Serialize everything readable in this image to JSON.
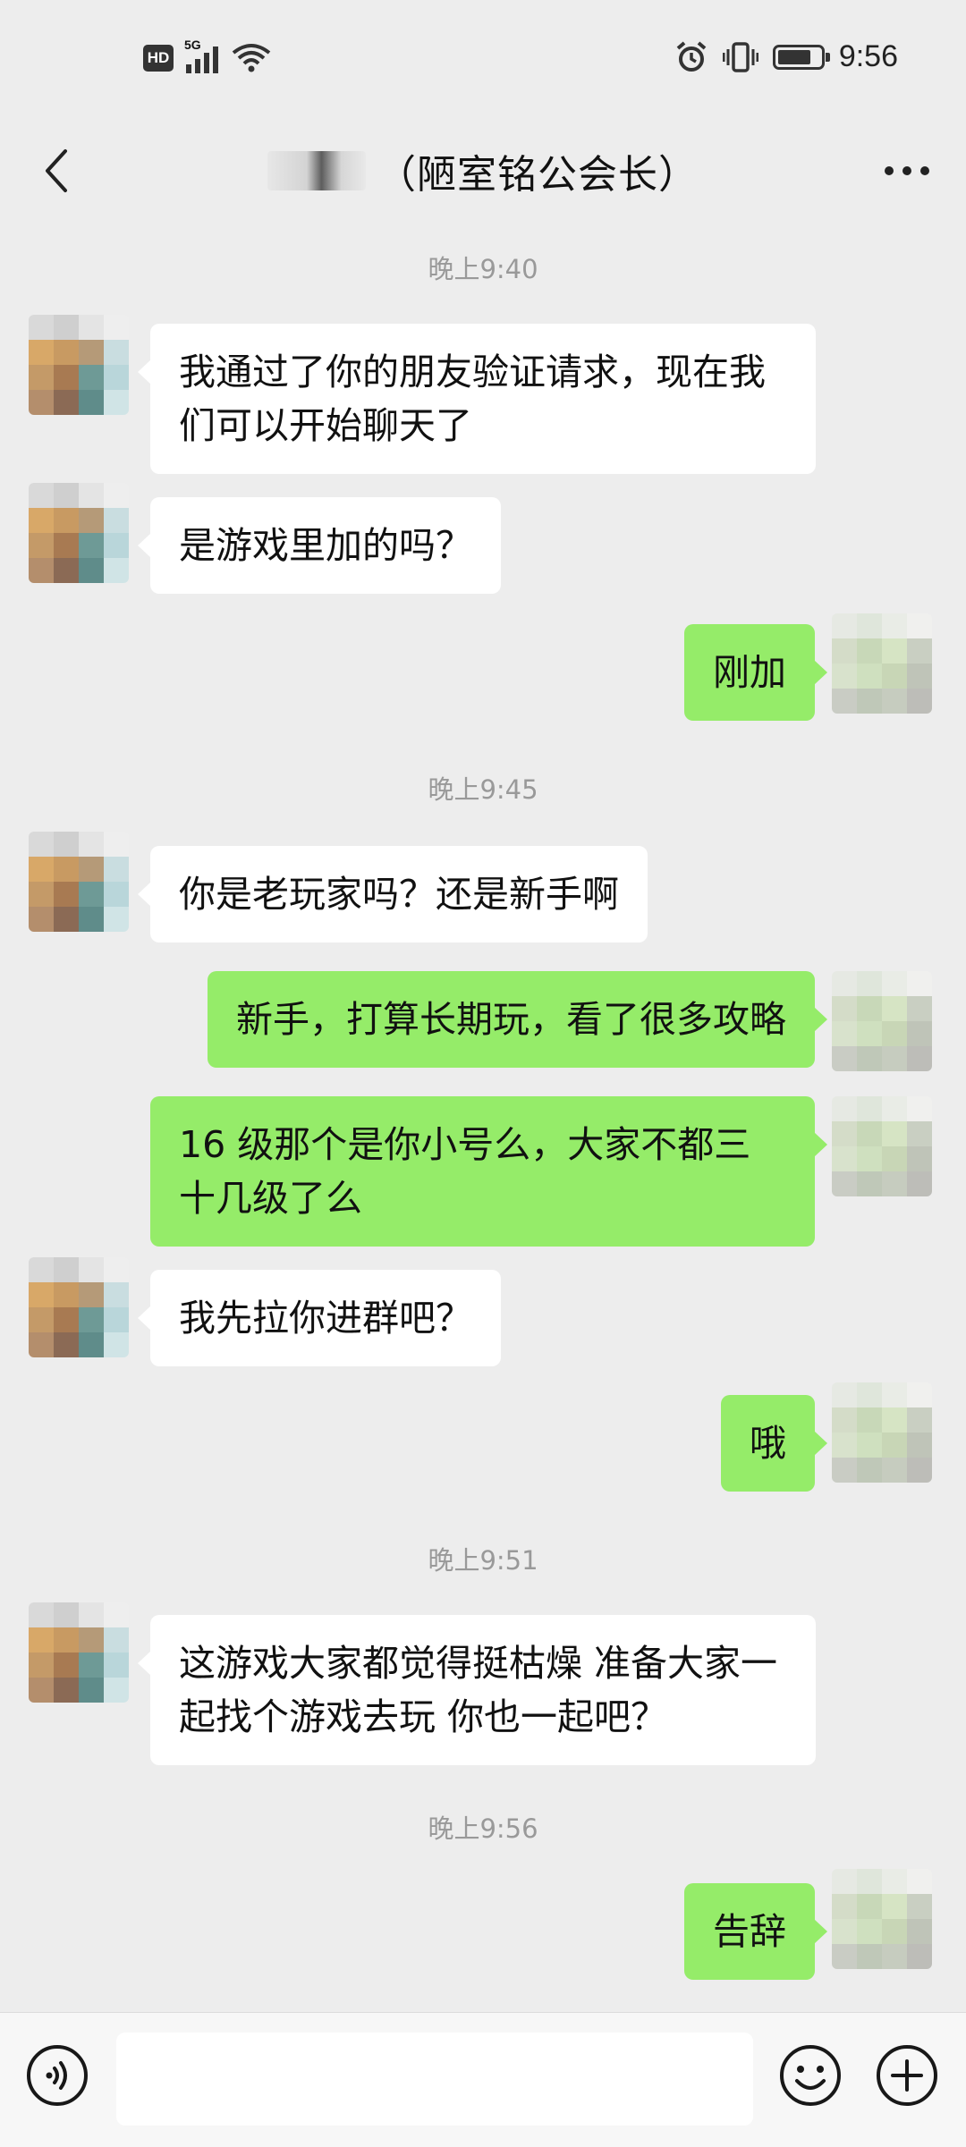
{
  "status_bar": {
    "hd_badge": "HD",
    "network": "5G",
    "time": "9:56",
    "icons": [
      "hd-icon",
      "signal-icon",
      "wifi-icon",
      "alarm-icon",
      "vibrate-icon",
      "battery-icon"
    ]
  },
  "header": {
    "title": "（陋室铭公会长）",
    "back_icon": "chevron-left-icon",
    "more_icon": "more-dots-icon"
  },
  "messages": [
    {
      "type": "timestamp",
      "text": "晚上9:40"
    },
    {
      "type": "in",
      "text": "我通过了你的朋友验证请求，现在我们可以开始聊天了"
    },
    {
      "type": "in",
      "text": "是游戏里加的吗？"
    },
    {
      "type": "out",
      "text": "刚加"
    },
    {
      "type": "timestamp",
      "text": "晚上9:45"
    },
    {
      "type": "in",
      "text": "你是老玩家吗？还是新手啊"
    },
    {
      "type": "out",
      "text": "新手，打算长期玩，看了很多攻略"
    },
    {
      "type": "out",
      "text": "16 级那个是你小号么，大家不都三十几级了么"
    },
    {
      "type": "in",
      "text": "我先拉你进群吧？"
    },
    {
      "type": "out",
      "text": "哦"
    },
    {
      "type": "timestamp",
      "text": "晚上9:51"
    },
    {
      "type": "in",
      "text": "这游戏大家都觉得挺枯燥 准备大家一起找个游戏去玩 你也一起吧？"
    },
    {
      "type": "timestamp",
      "text": "晚上9:56"
    },
    {
      "type": "out",
      "text": "告辞"
    }
  ],
  "input_bar": {
    "voice_icon": "voice-icon",
    "emoji_icon": "emoji-icon",
    "plus_icon": "plus-circle-icon",
    "text_value": ""
  },
  "colors": {
    "background": "#ededed",
    "incoming_bubble": "#ffffff",
    "outgoing_bubble": "#95ec69",
    "timestamp_text": "#999999"
  }
}
